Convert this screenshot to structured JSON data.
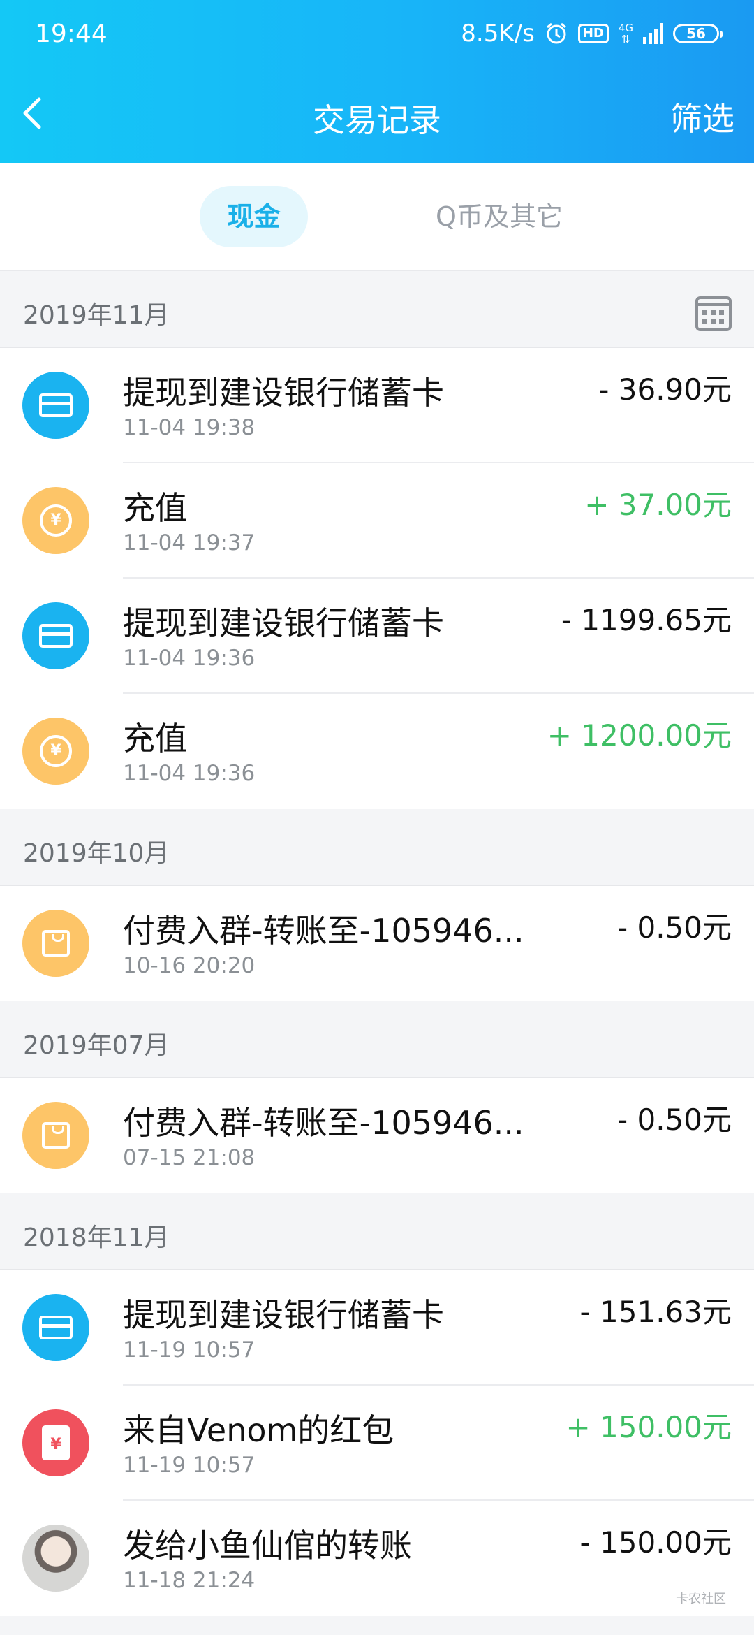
{
  "status_bar": {
    "time": "19:44",
    "speed": "8.5K/s",
    "hd": "HD",
    "network": "4G",
    "battery": "56"
  },
  "nav": {
    "title": "交易记录",
    "filter": "筛选"
  },
  "tabs": {
    "cash": "现金",
    "q": "Q币及其它"
  },
  "sections": [
    {
      "label": "2019年11月",
      "items": [
        {
          "title": "提现到建设银行储蓄卡",
          "time": "11-04 19:38",
          "amount": "- 36.90元",
          "icon": "card-icon"
        },
        {
          "title": "充值",
          "time": "11-04 19:37",
          "amount": "+ 37.00元",
          "icon": "yuan-coin-icon"
        },
        {
          "title": "提现到建设银行储蓄卡",
          "time": "11-04 19:36",
          "amount": "- 1199.65元",
          "icon": "card-icon"
        },
        {
          "title": "充值",
          "time": "11-04 19:36",
          "amount": "+ 1200.00元",
          "icon": "yuan-coin-icon"
        }
      ]
    },
    {
      "label": "2019年10月",
      "items": [
        {
          "title": "付费入群-转账至-105946...",
          "time": "10-16 20:20",
          "amount": "- 0.50元",
          "icon": "shopping-bag-icon"
        }
      ]
    },
    {
      "label": "2019年07月",
      "items": [
        {
          "title": "付费入群-转账至-105946...",
          "time": "07-15 21:08",
          "amount": "- 0.50元",
          "icon": "shopping-bag-icon"
        }
      ]
    },
    {
      "label": "2018年11月",
      "items": [
        {
          "title": "提现到建设银行储蓄卡",
          "time": "11-19 10:57",
          "amount": "- 151.63元",
          "icon": "card-icon"
        },
        {
          "title": "来自Venom的红包",
          "time": "11-19 10:57",
          "amount": "+ 150.00元",
          "icon": "red-envelope-icon"
        },
        {
          "title": "发给小鱼仙倌的转账",
          "time": "11-18 21:24",
          "amount": "- 150.00元",
          "icon": "avatar"
        }
      ]
    }
  ],
  "watermark": "卡农社区",
  "colors": {
    "accent": "#1ab3f0",
    "positive": "#3fbf65",
    "coin": "#fdc568",
    "red": "#f0515d"
  }
}
